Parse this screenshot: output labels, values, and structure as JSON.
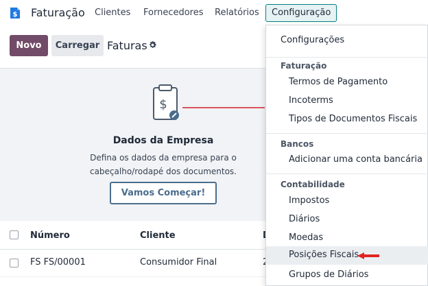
{
  "app": {
    "name": "Faturação",
    "logo_icon": "dollar-document-icon"
  },
  "nav": {
    "items": [
      {
        "label": "Clientes"
      },
      {
        "label": "Fornecedores"
      },
      {
        "label": "Relatórios"
      },
      {
        "label": "Configuração"
      }
    ]
  },
  "controls": {
    "new_label": "Novo",
    "upload_label": "Carregar",
    "title": "Faturas",
    "settings_icon": "gear-icon"
  },
  "helper": {
    "title": "Dados da Empresa",
    "desc_line1": "Defina os dados da empresa para o",
    "desc_line2": "cabeçalho/rodapé dos documentos.",
    "button": "Vamos Começar!"
  },
  "table": {
    "headers": [
      "Número",
      "Cliente",
      "D"
    ],
    "rows": [
      {
        "numero": "FS FS/00001",
        "cliente": "Consumidor Final",
        "d": "2"
      }
    ]
  },
  "dropdown": {
    "top_item": "Configurações",
    "sections": [
      {
        "header": "Faturação",
        "items": [
          "Termos de Pagamento",
          "Incoterms",
          "Tipos de Documentos Fiscais"
        ]
      },
      {
        "header": "Bancos",
        "items": [
          "Adicionar uma conta bancária"
        ]
      },
      {
        "header": "Contabilidade",
        "items": [
          "Impostos",
          "Diários",
          "Moedas",
          "Posições Fiscais",
          "Grupos de Diários"
        ]
      }
    ],
    "highlighted_item": "Posições Fiscais",
    "pointer_color": "#e02424"
  },
  "colors": {
    "primary": "#714b67",
    "accent": "#017e84",
    "link": "#4a6c8c"
  }
}
